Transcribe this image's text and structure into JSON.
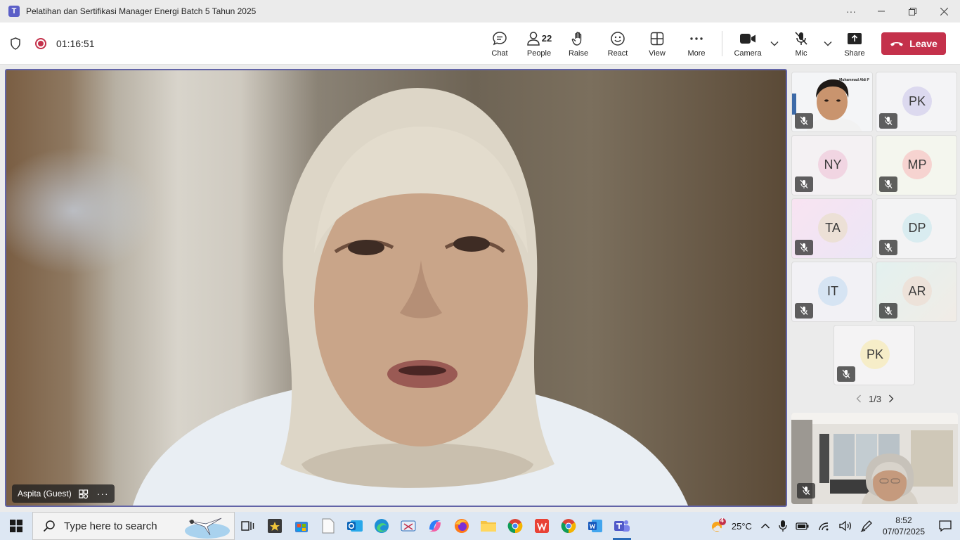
{
  "window": {
    "title": "Pelatihan dan Sertifikasi Manager Energi Batch 5 Tahun 2025",
    "app_icon": "teams-icon"
  },
  "meeting": {
    "timer": "01:16:51",
    "participant_count": "22",
    "buttons": {
      "chat": "Chat",
      "people": "People",
      "raise": "Raise",
      "react": "React",
      "view": "View",
      "more": "More",
      "camera": "Camera",
      "mic": "Mic",
      "share": "Share",
      "leave": "Leave"
    }
  },
  "stage": {
    "speaker_name": "Aspita (Guest)",
    "more_label": "···"
  },
  "gallery": {
    "tiles": [
      {
        "initials": "",
        "video": true,
        "caption": "Muhammad Aldi F"
      },
      {
        "initials": "PK",
        "color": "#dcd9ef"
      },
      {
        "initials": "NY",
        "color": "#f1d5e2"
      },
      {
        "initials": "MP",
        "color": "#f6d3d0"
      },
      {
        "initials": "TA",
        "color": "#ece0d6"
      },
      {
        "initials": "DP",
        "color": "#d9ecf0"
      },
      {
        "initials": "IT",
        "color": "#d6e4f3"
      },
      {
        "initials": "AR",
        "color": "#ede2d9"
      },
      {
        "initials": "PK",
        "color": "#f6edc8"
      }
    ],
    "page": "1/3"
  },
  "taskbar": {
    "search_placeholder": "Type here to search",
    "weather": "25°C",
    "weather_badge": "4",
    "time": "8:52",
    "date": "07/07/2025"
  },
  "colors": {
    "accent": "#6264a7",
    "leave": "#c4314b"
  }
}
